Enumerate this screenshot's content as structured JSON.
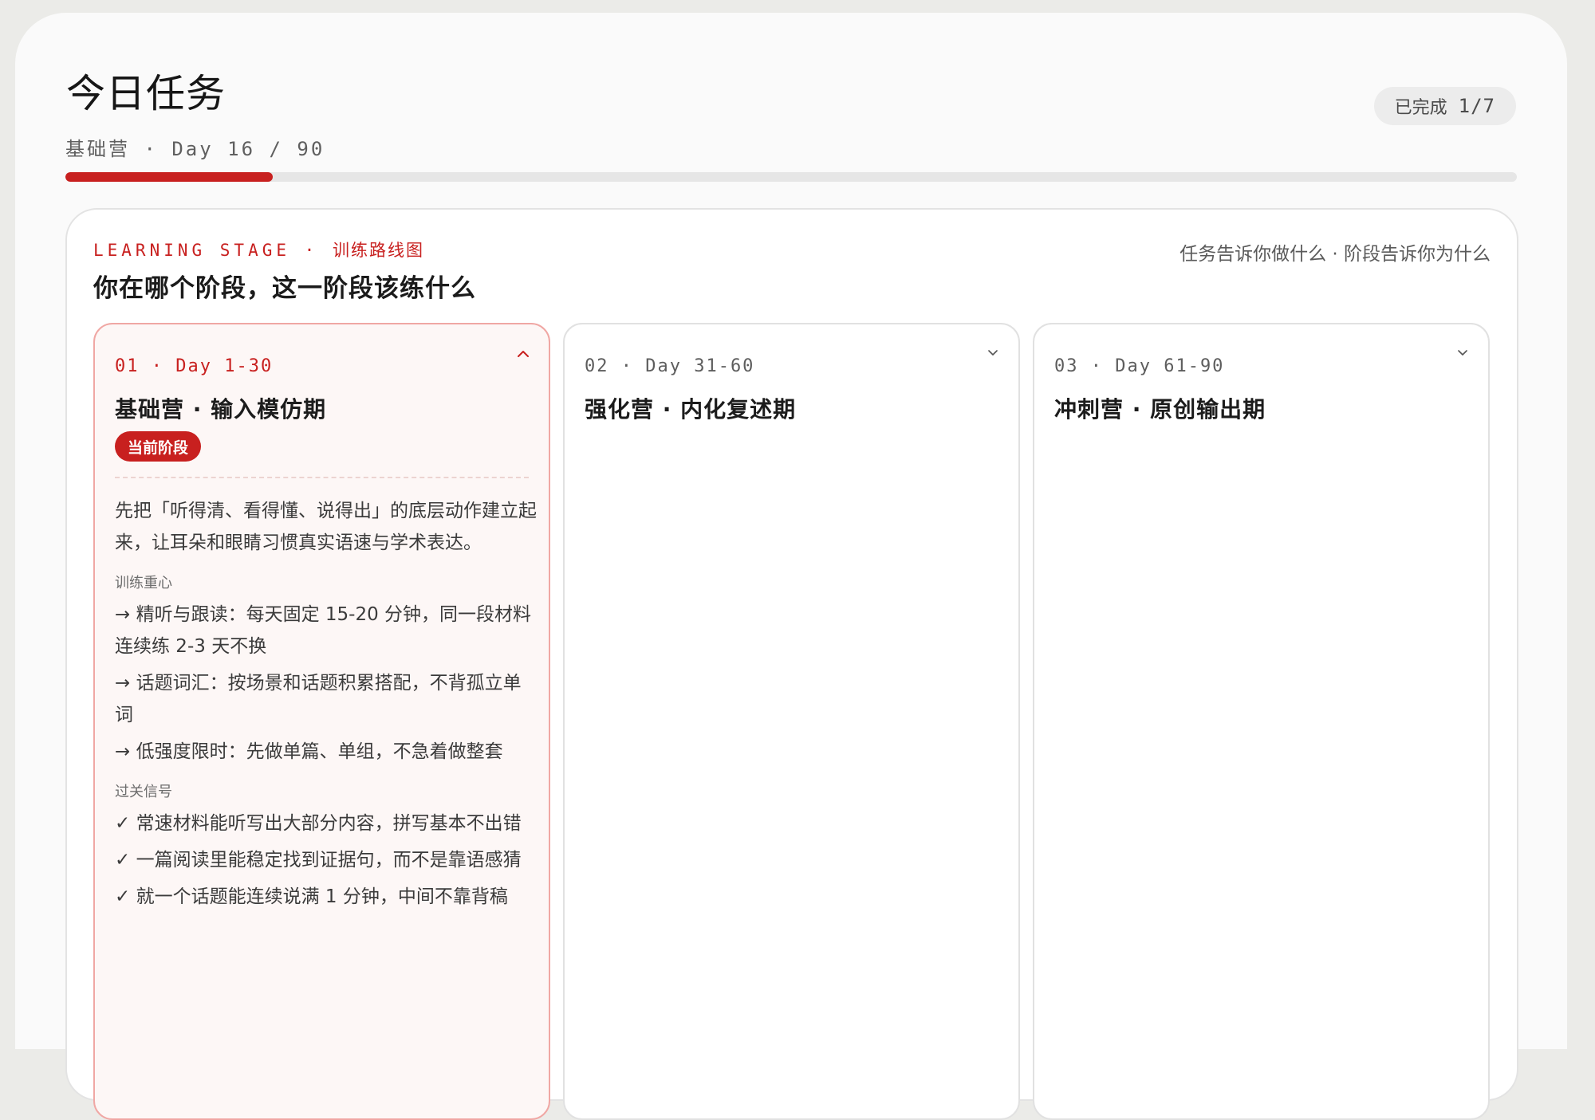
{
  "header": {
    "title": "今日任务",
    "subtitle": "基础营 · Day 16 / 90",
    "completion_label": "已完成",
    "completion_count": "1/7",
    "progress_fraction": 0.1428
  },
  "stage_panel": {
    "eyebrow_en": "LEARNING STAGE ·",
    "eyebrow_zh": "训练路线图",
    "heading": "你在哪个阶段，这一阶段该练什么",
    "hint": "任务告诉你做什么 · 阶段告诉你为什么"
  },
  "stages": [
    {
      "index": "01 · Day 1-30",
      "title": "基础营 · 输入模仿期",
      "badge": "当前阶段",
      "expanded": true,
      "chevron_icon": "chevron-up-icon",
      "description": "先把「听得清、看得懂、说得出」的底层动作建立起来，让耳朵和眼睛习惯真实语速与学术表达。",
      "focus_label": "训练重心",
      "focus_items": [
        "精听与跟读：每天固定 15-20 分钟，同一段材料连续练 2-3 天不换",
        "话题词汇：按场景和话题积累搭配，不背孤立单词",
        "低强度限时：先做单篇、单组，不急着做整套"
      ],
      "signals_label": "过关信号",
      "signal_items": [
        "常速材料能听写出大部分内容，拼写基本不出错",
        "一篇阅读里能稳定找到证据句，而不是靠语感猜",
        "就一个话题能连续说满 1 分钟，中间不靠背稿"
      ]
    },
    {
      "index": "02 · Day 31-60",
      "title": "强化营 · 内化复述期",
      "expanded": false,
      "chevron_icon": "chevron-down-icon"
    },
    {
      "index": "03 · Day 61-90",
      "title": "冲刺营 · 原创输出期",
      "expanded": false,
      "chevron_icon": "chevron-down-icon"
    }
  ],
  "glyphs": {
    "arrow": "→",
    "check": "✓"
  },
  "colors": {
    "accent": "#c8201f",
    "active_card_bg": "#fdf7f6",
    "active_card_border": "#f0a7a4"
  }
}
